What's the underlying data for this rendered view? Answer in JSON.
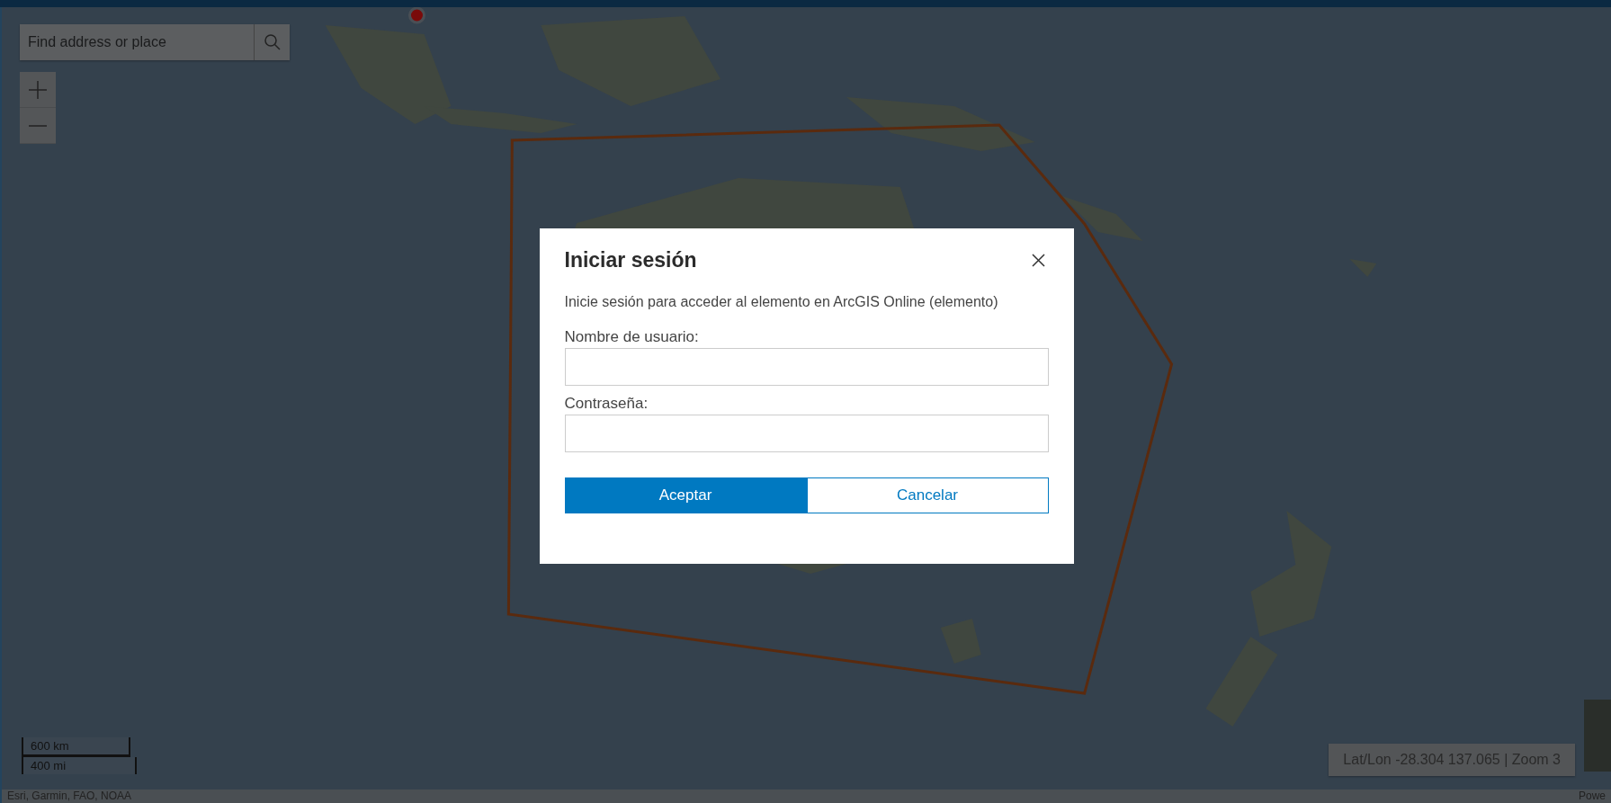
{
  "search": {
    "placeholder": "Find address or place"
  },
  "dialog": {
    "title": "Iniciar sesión",
    "message": "Inicie sesión para acceder al elemento en ArcGIS Online (elemento)",
    "fields": [
      {
        "label": "Nombre de usuario:"
      },
      {
        "label": "Contraseña:"
      }
    ],
    "buttons": [
      {
        "label": "Aceptar",
        "kind": "primary"
      },
      {
        "label": "Cancelar",
        "kind": "secondary"
      }
    ]
  },
  "scale_bar": [
    "600 km",
    "400 mi"
  ],
  "coordinates": "Lat/Lon -28.304 137.065 | Zoom 3",
  "attribution": "Esri, Garmin, FAO, NOAA",
  "powered_by": "Powe"
}
